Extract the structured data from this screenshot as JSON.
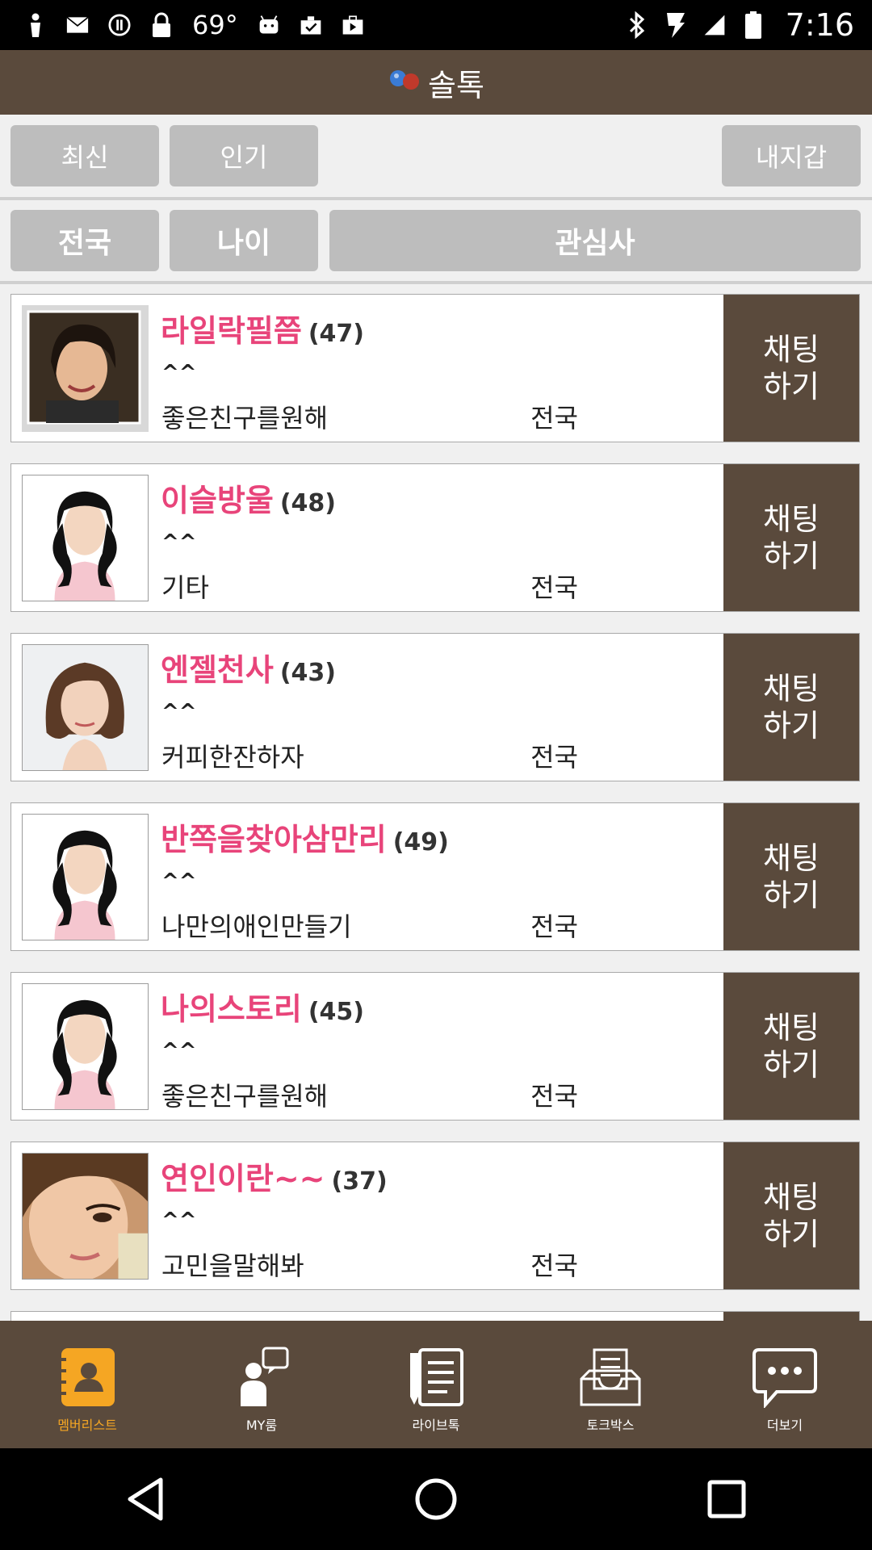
{
  "status_bar": {
    "temperature": "69°",
    "time": "7:16",
    "left_icons": [
      "person-icon",
      "mail-icon",
      "info-icon",
      "lock-icon",
      "android-icon",
      "clipboard-icon",
      "briefcase-icon"
    ],
    "right_icons": [
      "bluetooth-icon",
      "flash-icon",
      "signal-icon",
      "battery-icon"
    ]
  },
  "header": {
    "title": "솔톡",
    "logo_icon": "people-chat-logo-icon"
  },
  "sort_tabs": {
    "latest": "최신",
    "popular": "인기",
    "my_wallet": "내지갑"
  },
  "filters": {
    "region": "전국",
    "age": "나이",
    "interest": "관심사"
  },
  "chat_button": {
    "line1": "채팅",
    "line2": "하기"
  },
  "members": [
    {
      "nickname": "라일락필쯤",
      "age": "(47)",
      "status": "^^",
      "intro": "좋은친구를원해",
      "region": "전국",
      "avatar": "photo-woman-smiling"
    },
    {
      "nickname": "이슬방울",
      "age": "(48)",
      "status": "^^",
      "intro": "기타",
      "region": "전국",
      "avatar": "default-female-avatar"
    },
    {
      "nickname": "엔젤천사",
      "age": "(43)",
      "status": "^^",
      "intro": "커피한잔하자",
      "region": "전국",
      "avatar": "photo-woman-bob-hair"
    },
    {
      "nickname": "반쪽을찾아삼만리",
      "age": "(49)",
      "status": "^^",
      "intro": "나만의애인만들기",
      "region": "전국",
      "avatar": "default-female-avatar"
    },
    {
      "nickname": "나의스토리",
      "age": "(45)",
      "status": "^^",
      "intro": "좋은친구를원해",
      "region": "전국",
      "avatar": "default-female-avatar"
    },
    {
      "nickname": "연인이란~~",
      "age": "(37)",
      "status": "^^",
      "intro": "고민을말해봐",
      "region": "전국",
      "avatar": "photo-woman-closeup"
    }
  ],
  "bottom_nav": [
    {
      "label": "멤버리스트",
      "icon": "member-list-icon",
      "active": true
    },
    {
      "label": "MY룸",
      "icon": "my-room-icon",
      "active": false
    },
    {
      "label": "라이브톡",
      "icon": "live-talk-icon",
      "active": false
    },
    {
      "label": "토크박스",
      "icon": "talk-box-icon",
      "active": false
    },
    {
      "label": "더보기",
      "icon": "more-icon",
      "active": false
    }
  ],
  "colors": {
    "brown": "#5a4a3c",
    "pink": "#e8447a",
    "gray_button": "#bdbdbd",
    "active_orange": "#f5a623"
  }
}
